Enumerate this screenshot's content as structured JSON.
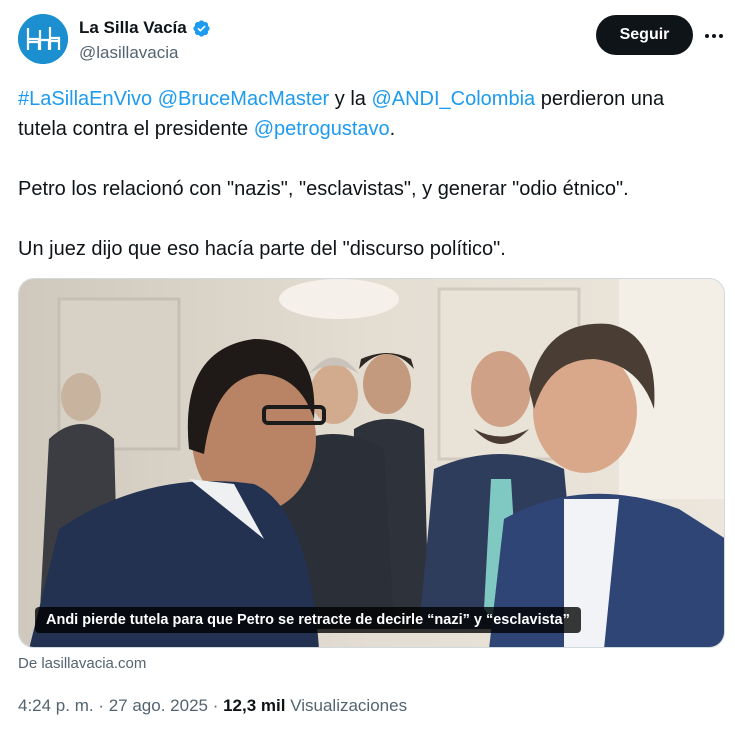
{
  "account": {
    "display_name": "La Silla Vacía",
    "handle": "@lasillavacia",
    "avatar_icon": "chairs-logo-icon",
    "verified_icon": "verified-badge-icon",
    "brand_color": "#1c8fd1"
  },
  "actions": {
    "follow_label": "Seguir",
    "more_icon": "more-options-icon"
  },
  "tweet": {
    "hashtag": "#LaSillaEnVivo",
    "mention_1": "@BruceMacMaster",
    "text_1": " y la ",
    "mention_2": "@ANDI_Colombia",
    "text_2": " perdieron una tutela contra el presidente ",
    "mention_3": "@petrogustavo",
    "text_3": ".",
    "paragraph_2": "Petro los relacionó con \"nazis\", \"esclavistas\", y generar \"odio étnico\".",
    "paragraph_3": "Un juez dijo que eso hacía parte del \"discurso político\"."
  },
  "media": {
    "caption": "Andi pierde tutela para que Petro se retracte de decirle “nazi” y “esclavista”",
    "source": "De lasillavacia.com"
  },
  "meta": {
    "time": "4:24 p. m.",
    "separator": " · ",
    "date": "27 ago. 2025",
    "views_count": "12,3 mil",
    "views_label": "Visualizaciones"
  },
  "colors": {
    "link": "#1d9bf0",
    "text": "#0f1419",
    "muted": "#536471"
  }
}
